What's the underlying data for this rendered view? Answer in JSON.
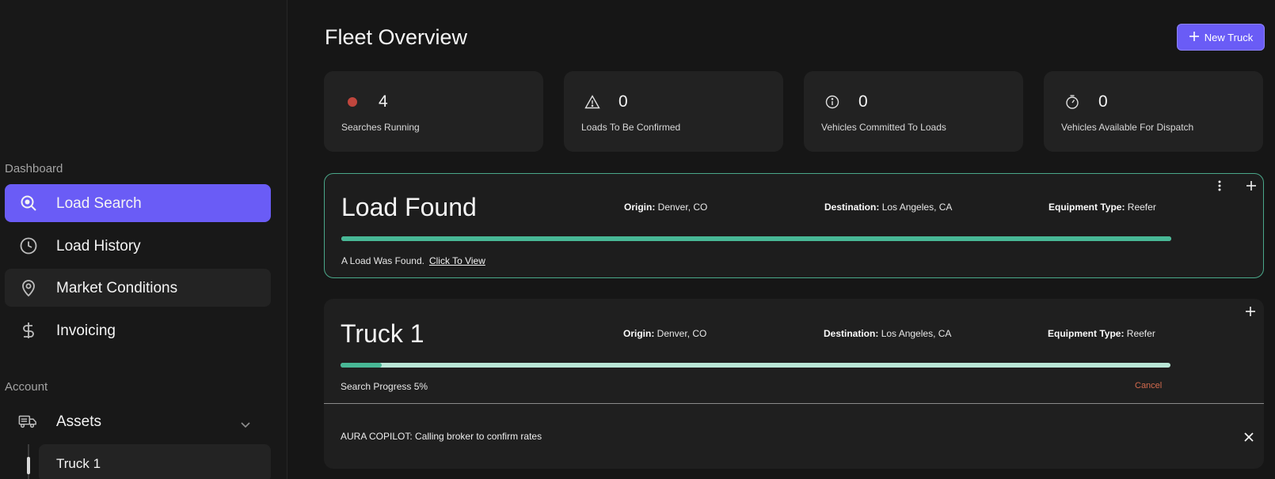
{
  "sidebar": {
    "dashboard_label": "Dashboard",
    "items": [
      {
        "label": "Load Search",
        "icon": "search-icon"
      },
      {
        "label": "Load History",
        "icon": "clock-icon"
      },
      {
        "label": "Market Conditions",
        "icon": "map-pin-icon"
      },
      {
        "label": "Invoicing",
        "icon": "dollar-icon"
      }
    ],
    "account_label": "Account",
    "assets": {
      "label": "Assets",
      "icon": "truck-icon"
    },
    "sub_items": [
      {
        "label": "Truck 1"
      }
    ]
  },
  "header": {
    "title": "Fleet Overview",
    "new_truck_label": "New Truck"
  },
  "stats": [
    {
      "value": "4",
      "label": "Searches Running",
      "icon": "status-dot-icon",
      "color": "#c0463d"
    },
    {
      "value": "0",
      "label": "Loads To Be Confirmed",
      "icon": "warning-icon"
    },
    {
      "value": "0",
      "label": "Vehicles Committed To Loads",
      "icon": "info-icon"
    },
    {
      "value": "0",
      "label": "Vehicles Available For Dispatch",
      "icon": "timer-icon"
    }
  ],
  "load_card": {
    "title": "Load Found",
    "origin_label": "Origin:",
    "origin": "Denver, CO",
    "destination_label": "Destination:",
    "destination": "Los Angeles, CA",
    "equipment_label": "Equipment Type:",
    "equipment": "Reefer",
    "progress": 1.0,
    "message": "A Load Was Found.",
    "link": "Click To View"
  },
  "truck_card": {
    "title": "Truck 1",
    "origin_label": "Origin:",
    "origin": "Denver, CO",
    "destination_label": "Destination:",
    "destination": "Los Angeles, CA",
    "equipment_label": "Equipment Type:",
    "equipment": "Reefer",
    "progress": 0.05,
    "progress_text": "Search Progress 5%",
    "cancel": "Cancel",
    "copilot": "AURA COPILOT: Calling broker to confirm rates"
  },
  "colors": {
    "accent": "#6a5cf6",
    "progress": "#48b896",
    "progress_track": "#b9e6d6",
    "cancel": "#d36a4d"
  }
}
